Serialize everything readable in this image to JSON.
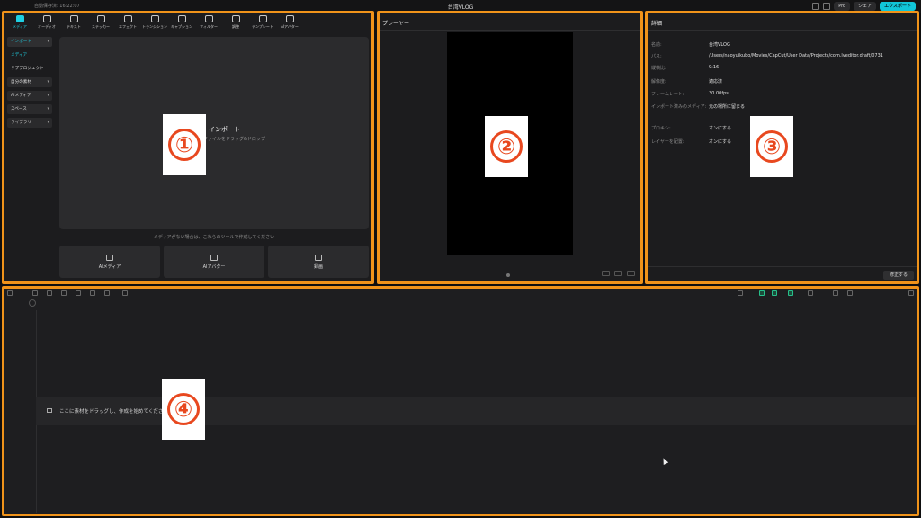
{
  "topbar": {
    "autosave": "自動保存済: 16:22:07",
    "title": "台湾VLOG",
    "pro": "Pro",
    "share": "シェア",
    "export": "エクスポート"
  },
  "media_tools": [
    {
      "label": "メディア",
      "icon": "media-icon",
      "active": true
    },
    {
      "label": "オーディオ",
      "icon": "audio-icon"
    },
    {
      "label": "テキスト",
      "icon": "text-icon"
    },
    {
      "label": "ステッカー",
      "icon": "sticker-icon"
    },
    {
      "label": "エフェクト",
      "icon": "effect-icon"
    },
    {
      "label": "トランジション",
      "icon": "transition-icon"
    },
    {
      "label": "キャプション",
      "icon": "caption-icon"
    },
    {
      "label": "フィルター",
      "icon": "filter-icon"
    },
    {
      "label": "調整",
      "icon": "adjust-icon"
    },
    {
      "label": "テンプレート",
      "icon": "template-icon"
    },
    {
      "label": "AIアバター",
      "icon": "ai-avatar-icon"
    }
  ],
  "sidenav": [
    {
      "label": "インポート",
      "style": "active",
      "chevron": "▾"
    },
    {
      "label": "メディア",
      "style": "cyan"
    },
    {
      "label": "サブプロジェクト",
      "style": "plain"
    },
    {
      "label": "自分の素材",
      "style": "box",
      "chevron": "▾"
    },
    {
      "label": "AIメディア",
      "style": "box",
      "chevron": "▾"
    },
    {
      "label": "スペース",
      "style": "box",
      "chevron": "▾"
    },
    {
      "label": "ライブラリ",
      "style": "box",
      "chevron": "▾"
    }
  ],
  "importbox": {
    "label": "インポート",
    "hint": "ファイルをドラッグ&ドロップ"
  },
  "media_hint": "メディアがない場合は、これらのツールで作成してください",
  "tool_cards": [
    {
      "label": "AIメディア",
      "icon": "ai-media-icon"
    },
    {
      "label": "AIアバター",
      "icon": "ai-avatar-icon"
    },
    {
      "label": "録画",
      "icon": "record-icon"
    }
  ],
  "player": {
    "header": "プレーヤー"
  },
  "details": {
    "header": "詳細",
    "rows": [
      {
        "prop": "名前:",
        "value": "台湾VLOG"
      },
      {
        "prop": "パス:",
        "value": "/Users/naoyuikubo/Movies/CapCut/User Data/Projects/com.lveditor.draft/0731"
      },
      {
        "prop": "縦横比:",
        "value": "9:16"
      },
      {
        "prop": "解像度:",
        "value": "適応済"
      },
      {
        "prop": "フレームレート:",
        "value": "30.00fps"
      },
      {
        "prop": "インポート済みのメディア:",
        "value": "元の場所に留まる"
      },
      {
        "prop": "プロキシ:",
        "value": "オンにする"
      },
      {
        "prop": "レイヤーを配置:",
        "value": "オンにする"
      }
    ],
    "modify_button": "修正する"
  },
  "timeline": {
    "track_hint": "ここに素材をドラッグし、作成を始めてください"
  },
  "badges": [
    "①",
    "②",
    "③",
    "④"
  ],
  "colors": {
    "accent": "#1fd0e3",
    "highlight_frame": "#f0931a",
    "badge_red": "#e8481f"
  }
}
